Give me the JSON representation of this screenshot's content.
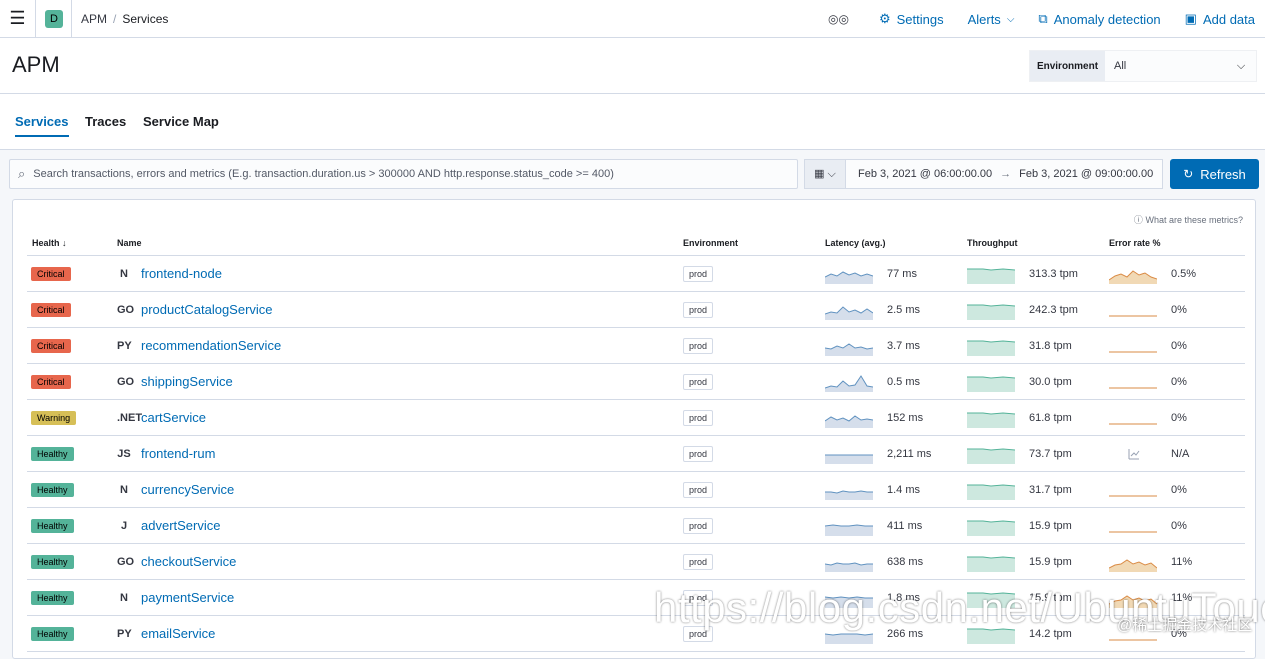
{
  "topbar": {
    "space_letter": "D",
    "breadcrumbs": [
      "APM",
      "Services"
    ],
    "nav": {
      "settings": "Settings",
      "alerts": "Alerts",
      "anomaly": "Anomaly detection",
      "add_data": "Add data"
    }
  },
  "header": {
    "title": "APM",
    "environment_label": "Environment",
    "environment_value": "All"
  },
  "tabs": [
    "Services",
    "Traces",
    "Service Map"
  ],
  "search": {
    "placeholder": "Search transactions, errors and metrics (E.g. transaction.duration.us > 300000 AND http.response.status_code >= 400)"
  },
  "datepicker": {
    "start": "Feb 3, 2021 @ 06:00:00.00",
    "end": "Feb 3, 2021 @ 09:00:00.00"
  },
  "refresh_label": "Refresh",
  "table": {
    "help": "What are these metrics?",
    "columns": [
      "Health",
      "Name",
      "Environment",
      "Latency (avg.)",
      "Throughput",
      "Error rate %"
    ],
    "rows": [
      {
        "health": "Critical",
        "icon": "N",
        "name": "frontend-node",
        "env": "prod",
        "latency": "77 ms",
        "throughput": "313.3 tpm",
        "error": "0.5%"
      },
      {
        "health": "Critical",
        "icon": "GO",
        "name": "productCatalogService",
        "env": "prod",
        "latency": "2.5 ms",
        "throughput": "242.3 tpm",
        "error": "0%"
      },
      {
        "health": "Critical",
        "icon": "PY",
        "name": "recommendationService",
        "env": "prod",
        "latency": "3.7 ms",
        "throughput": "31.8 tpm",
        "error": "0%"
      },
      {
        "health": "Critical",
        "icon": "GO",
        "name": "shippingService",
        "env": "prod",
        "latency": "0.5 ms",
        "throughput": "30.0 tpm",
        "error": "0%"
      },
      {
        "health": "Warning",
        "icon": ".NET",
        "name": "cartService",
        "env": "prod",
        "latency": "152 ms",
        "throughput": "61.8 tpm",
        "error": "0%"
      },
      {
        "health": "Healthy",
        "icon": "JS",
        "name": "frontend-rum",
        "env": "prod",
        "latency": "2,211 ms",
        "throughput": "73.7 tpm",
        "error": "N/A"
      },
      {
        "health": "Healthy",
        "icon": "N",
        "name": "currencyService",
        "env": "prod",
        "latency": "1.4 ms",
        "throughput": "31.7 tpm",
        "error": "0%"
      },
      {
        "health": "Healthy",
        "icon": "J",
        "name": "advertService",
        "env": "prod",
        "latency": "411 ms",
        "throughput": "15.9 tpm",
        "error": "0%"
      },
      {
        "health": "Healthy",
        "icon": "GO",
        "name": "checkoutService",
        "env": "prod",
        "latency": "638 ms",
        "throughput": "15.9 tpm",
        "error": "11%"
      },
      {
        "health": "Healthy",
        "icon": "N",
        "name": "paymentService",
        "env": "prod",
        "latency": "1.8 ms",
        "throughput": "15.9 tpm",
        "error": "11%"
      },
      {
        "health": "Healthy",
        "icon": "PY",
        "name": "emailService",
        "env": "prod",
        "latency": "266 ms",
        "throughput": "14.2 tpm",
        "error": "0%"
      }
    ]
  },
  "watermark": "https://blog.csdn.net/UbuntuTouch",
  "watermark_small": "@稀土掘金技术社区",
  "colors": {
    "accent": "#006bb4",
    "critical": "#e7664c",
    "warning": "#d6bf57",
    "healthy": "#54b399"
  }
}
